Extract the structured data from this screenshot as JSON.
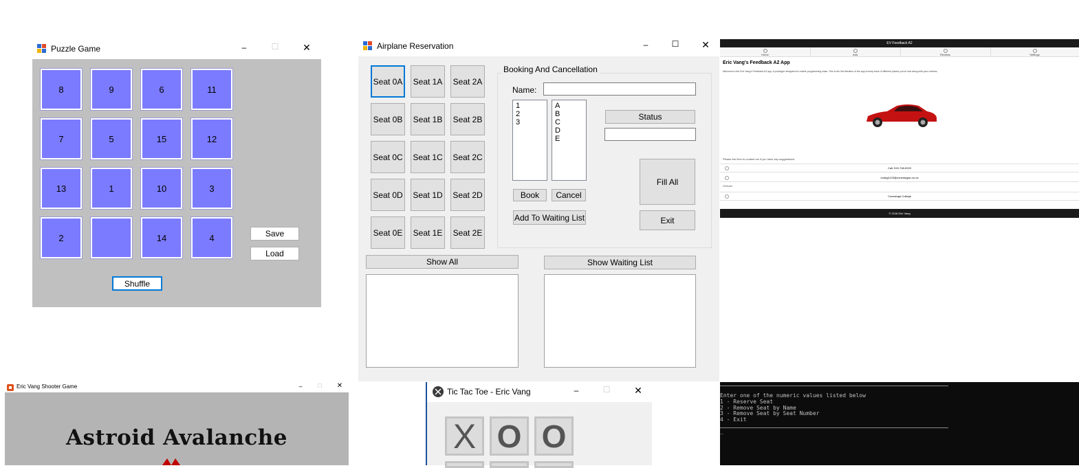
{
  "puzzle": {
    "title": "Puzzle Game",
    "tiles": [
      "8",
      "9",
      "6",
      "11",
      "7",
      "5",
      "15",
      "12",
      "13",
      "1",
      "10",
      "3",
      "2",
      "",
      "14",
      "4"
    ],
    "save_label": "Save",
    "load_label": "Load",
    "shuffle_label": "Shuffle",
    "bg_color": "#c0c0c0",
    "tile_color": "#7b7bff"
  },
  "airplane": {
    "title": "Airplane Reservation",
    "seats": [
      [
        "Seat 0A",
        "Seat 1A",
        "Seat 2A"
      ],
      [
        "Seat 0B",
        "Seat 1B",
        "Seat 2B"
      ],
      [
        "Seat 0C",
        "Seat 1C",
        "Seat 2C"
      ],
      [
        "Seat 0D",
        "Seat 1D",
        "Seat 2D"
      ],
      [
        "Seat 0E",
        "Seat 1E",
        "Seat 2E"
      ]
    ],
    "group_label": "Booking And Cancellation",
    "name_label": "Name:",
    "rows_list": [
      "1",
      "2",
      "3"
    ],
    "cols_list": [
      "A",
      "B",
      "C",
      "D",
      "E"
    ],
    "status_label": "Status",
    "book_label": "Book",
    "cancel_label": "Cancel",
    "fill_all_label": "Fill All",
    "waiting_label": "Add To Waiting List",
    "exit_label": "Exit",
    "show_all_label": "Show All",
    "show_waiting_label": "Show Waiting List"
  },
  "feedback": {
    "header": "EV Feedback A2",
    "nav": [
      "Home",
      "Add",
      "Reviews",
      "Settings"
    ],
    "title": "Eric Vang's Feedback A2 App",
    "intro": "Welcome to the Eric Vang's Feedback A2 app. A prototype designed for mobile programming class. This is the first iteration of the app to keep track of different places you've had along with your reviews.",
    "contact_text": "Please feel free to contact me if you have any suggestions!",
    "call": "Call: 519-748-5220",
    "email": "evang1123@conestogac.on.ca",
    "website_label": "Website",
    "college": "Conestoga College",
    "footer": "© 2018 Eric Vang"
  },
  "shooter": {
    "title": "Eric Vang Shooter Game",
    "game_title": "Astroid Avalanche"
  },
  "tictactoe": {
    "title": "Tic Tac Toe - Eric Vang",
    "cells": [
      "X",
      "O",
      "O"
    ]
  },
  "console": {
    "lines": [
      "Enter one of the numeric values listed below",
      "1 - Reserve Seat",
      "2 - Remove Seat by Name",
      "3 - Remove Seat by Seat Number",
      "4 - Exit",
      "_"
    ]
  },
  "window_controls": {
    "minimize": "–",
    "maximize": "☐",
    "close": "✕"
  }
}
